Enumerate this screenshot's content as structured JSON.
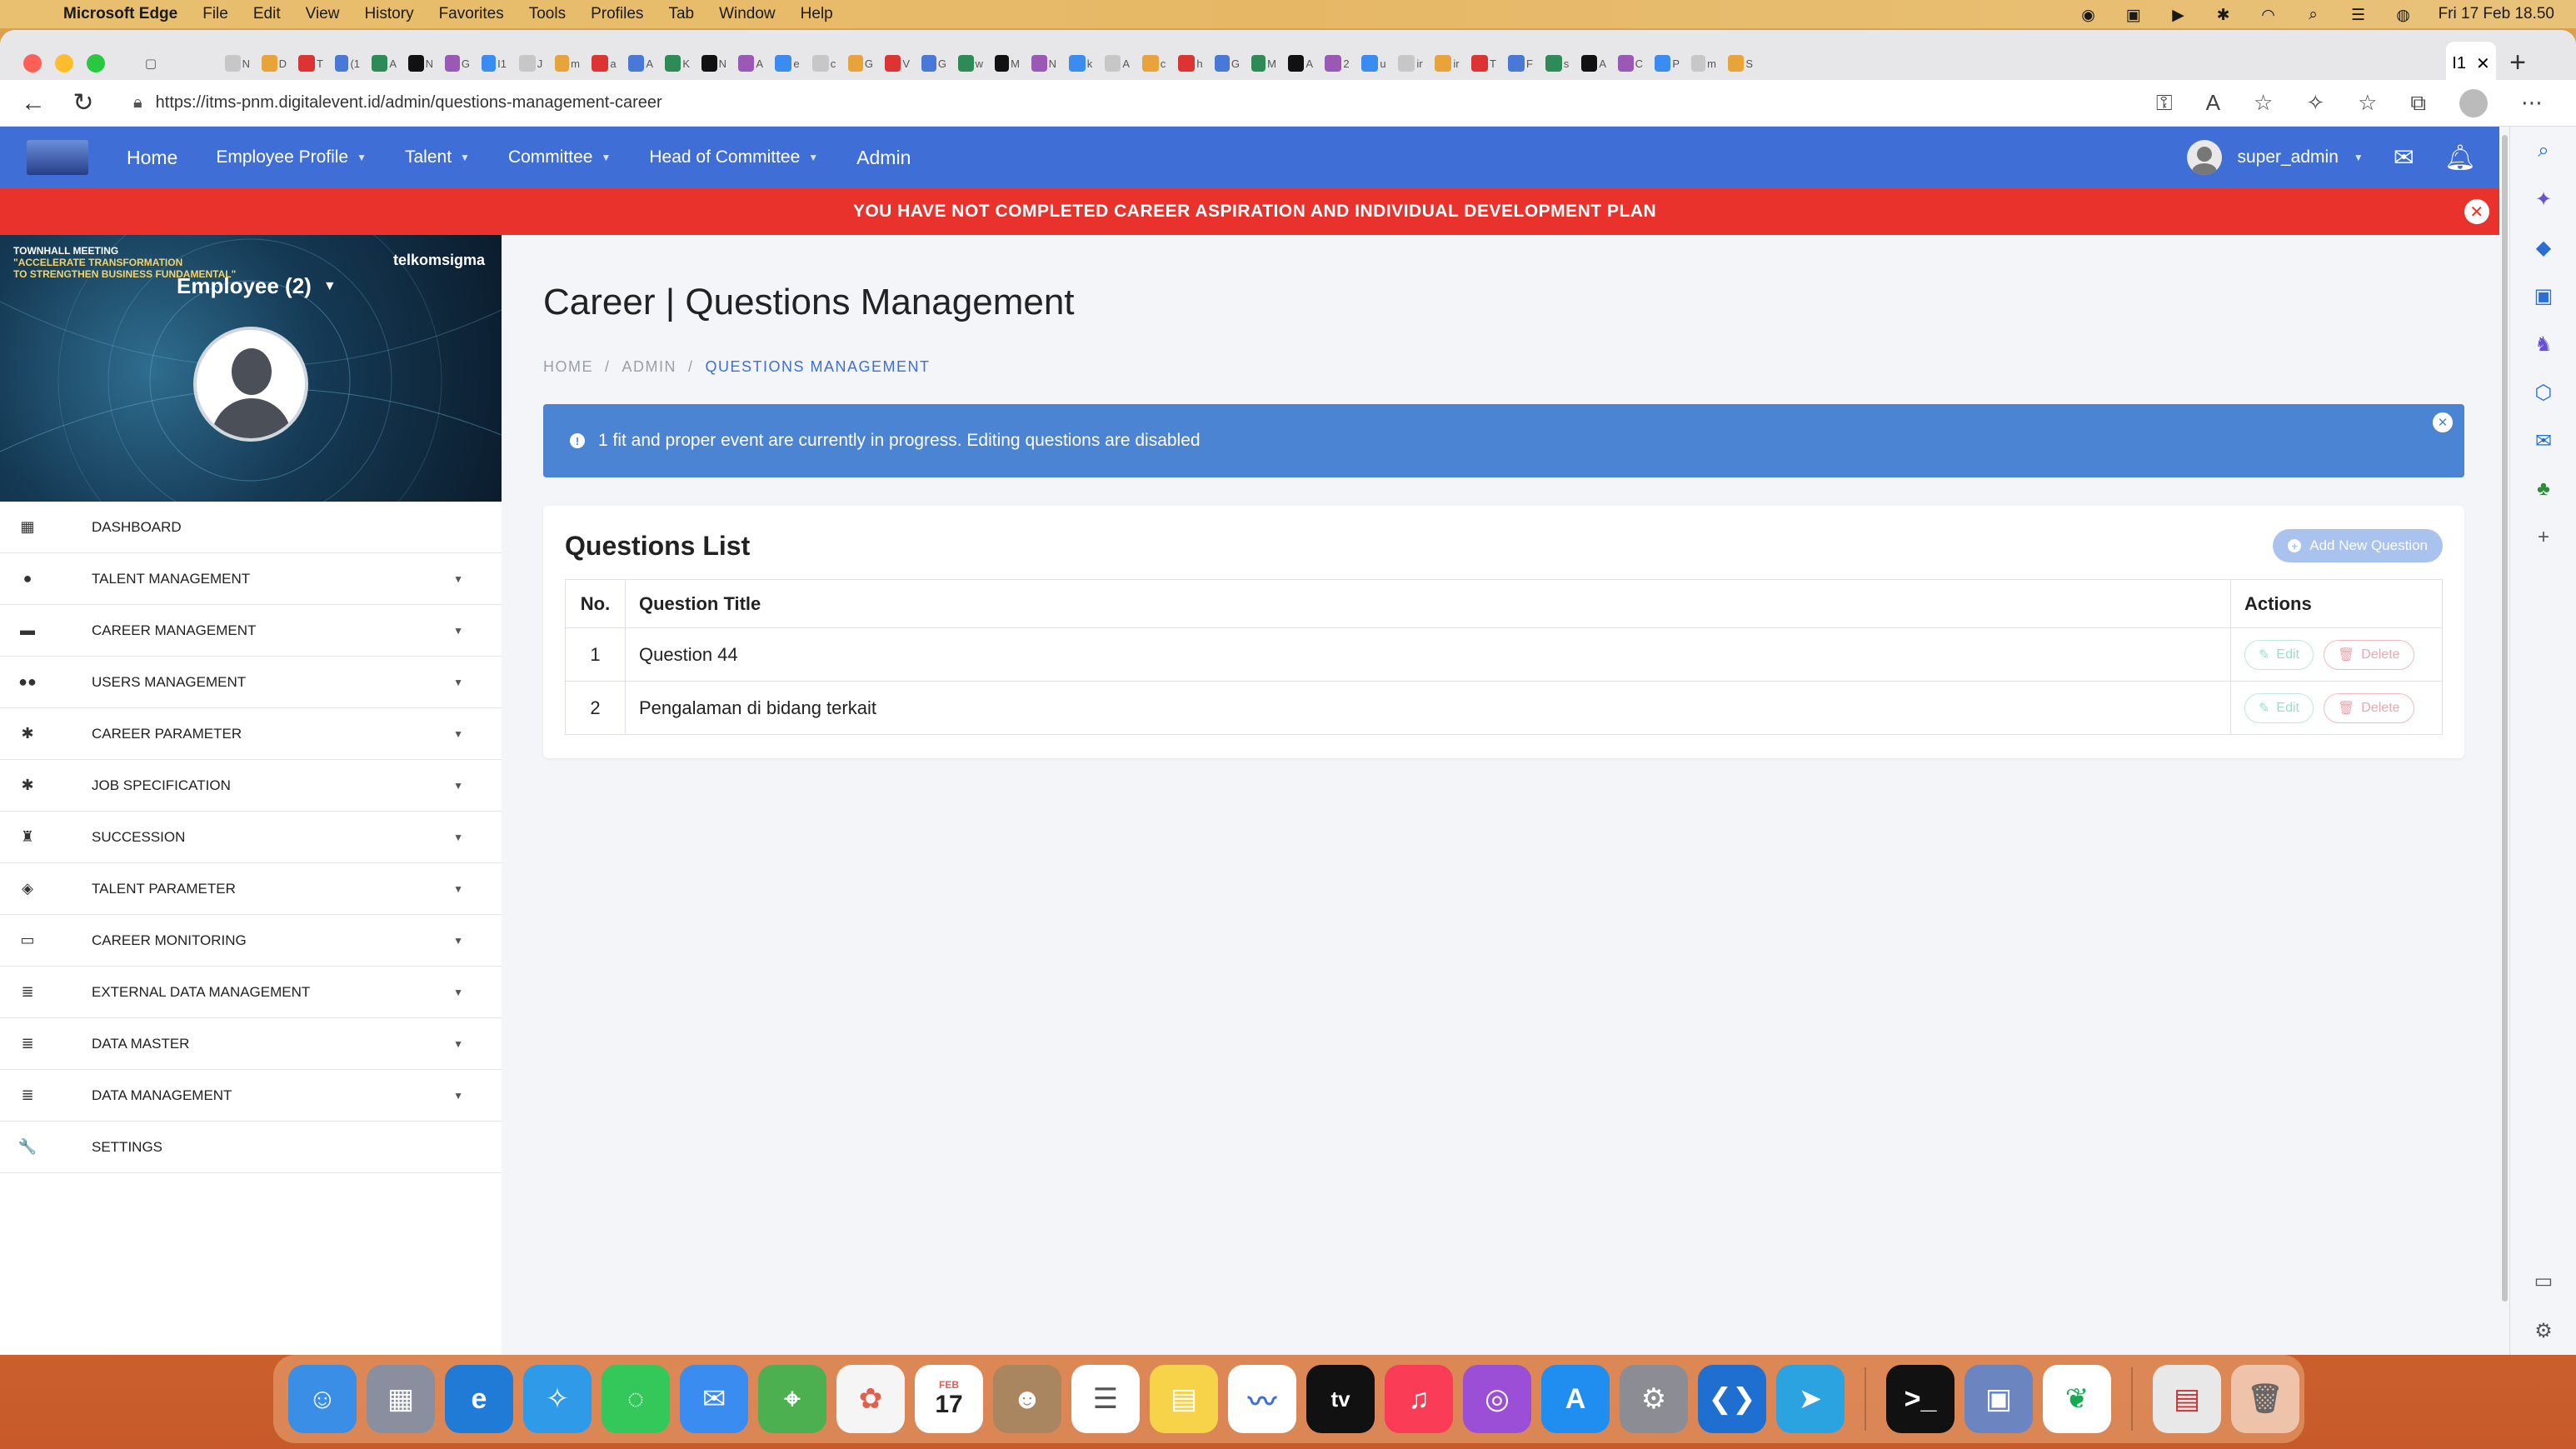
{
  "menubar": {
    "app_name": "Microsoft Edge",
    "items": [
      "File",
      "Edit",
      "View",
      "History",
      "Favorites",
      "Tools",
      "Profiles",
      "Tab",
      "Window",
      "Help"
    ],
    "clock": "Fri 17 Feb 18.50"
  },
  "browser": {
    "url": "https://itms-pnm.digitalevent.id/admin/questions-management-career",
    "active_tab_label": "I1",
    "tab_favicons": [
      "N",
      "D",
      "T",
      "(1",
      "A",
      "N",
      "G",
      "I1",
      "J",
      "m",
      "a",
      "A",
      "K",
      "N",
      "A",
      "e",
      "c",
      "G",
      "V",
      "G",
      "w",
      "M",
      "N",
      "k",
      "A",
      "c",
      "h",
      "G",
      "M",
      "A",
      "2",
      "u",
      "ir",
      "ir",
      "T",
      "F",
      "s",
      "A",
      "C",
      "P",
      "m",
      "S"
    ]
  },
  "topnav": {
    "items": [
      {
        "label": "Home",
        "dropdown": false
      },
      {
        "label": "Employee Profile",
        "dropdown": true
      },
      {
        "label": "Talent",
        "dropdown": true
      },
      {
        "label": "Committee",
        "dropdown": true
      },
      {
        "label": "Head of Committee",
        "dropdown": true
      },
      {
        "label": "Admin",
        "dropdown": false
      }
    ],
    "username": "super_admin"
  },
  "alert_banner": {
    "text": "YOU HAVE NOT COMPLETED CAREER ASPIRATION AND INDIVIDUAL DEVELOPMENT PLAN"
  },
  "sidebar": {
    "banner_title_line1": "TOWNHALL MEETING",
    "banner_title_line2": "\"ACCELERATE TRANSFORMATION",
    "banner_title_line3": "TO STRENGTHEN BUSINESS FUNDAMENTAL\"",
    "banner_brand": "telkomsigma",
    "role_selector": "Employee (2)",
    "items": [
      {
        "label": "DASHBOARD",
        "icon": "grid-icon",
        "glyph": "▦",
        "expandable": false
      },
      {
        "label": "TALENT MANAGEMENT",
        "icon": "user-icon",
        "glyph": "●",
        "expandable": true
      },
      {
        "label": "CAREER MANAGEMENT",
        "icon": "briefcase-icon",
        "glyph": "▬",
        "expandable": true
      },
      {
        "label": "USERS MANAGEMENT",
        "icon": "users-icon",
        "glyph": "●●",
        "expandable": true
      },
      {
        "label": "CAREER PARAMETER",
        "icon": "gear-icon",
        "glyph": "✱",
        "expandable": true
      },
      {
        "label": "JOB SPECIFICATION",
        "icon": "gear-icon",
        "glyph": "✱",
        "expandable": true
      },
      {
        "label": "SUCCESSION",
        "icon": "chess-icon",
        "glyph": "♜",
        "expandable": true
      },
      {
        "label": "TALENT PARAMETER",
        "icon": "cube-icon",
        "glyph": "◈",
        "expandable": true
      },
      {
        "label": "CAREER MONITORING",
        "icon": "monitor-icon",
        "glyph": "▭",
        "expandable": true
      },
      {
        "label": "EXTERNAL DATA MANAGEMENT",
        "icon": "database-icon",
        "glyph": "≣",
        "expandable": true
      },
      {
        "label": "DATA MASTER",
        "icon": "database-icon",
        "glyph": "≣",
        "expandable": true
      },
      {
        "label": "DATA MANAGEMENT",
        "icon": "database-icon",
        "glyph": "≣",
        "expandable": true
      },
      {
        "label": "SETTINGS",
        "icon": "wrench-icon",
        "glyph": "🔧",
        "expandable": false
      }
    ]
  },
  "main": {
    "page_title": "Career | Questions Management",
    "breadcrumb": [
      "HOME",
      "ADMIN",
      "QUESTIONS MANAGEMENT"
    ],
    "info_alert": "1 fit and proper event are currently in progress. Editing questions are disabled",
    "card_title": "Questions List",
    "add_button": "Add New Question",
    "table": {
      "headers": [
        "No.",
        "Question Title",
        "Actions"
      ],
      "rows": [
        {
          "no": "1",
          "title": "Question 44"
        },
        {
          "no": "2",
          "title": "Pengalaman di bidang terkait"
        }
      ],
      "edit_label": "Edit",
      "delete_label": "Delete"
    }
  },
  "colors": {
    "nav_blue": "#3f6fd6",
    "alert_red": "#e8322b",
    "info_blue": "#4a84d2"
  },
  "dock": {
    "calendar_month": "FEB",
    "calendar_day": "17",
    "tv_label": "tv"
  }
}
